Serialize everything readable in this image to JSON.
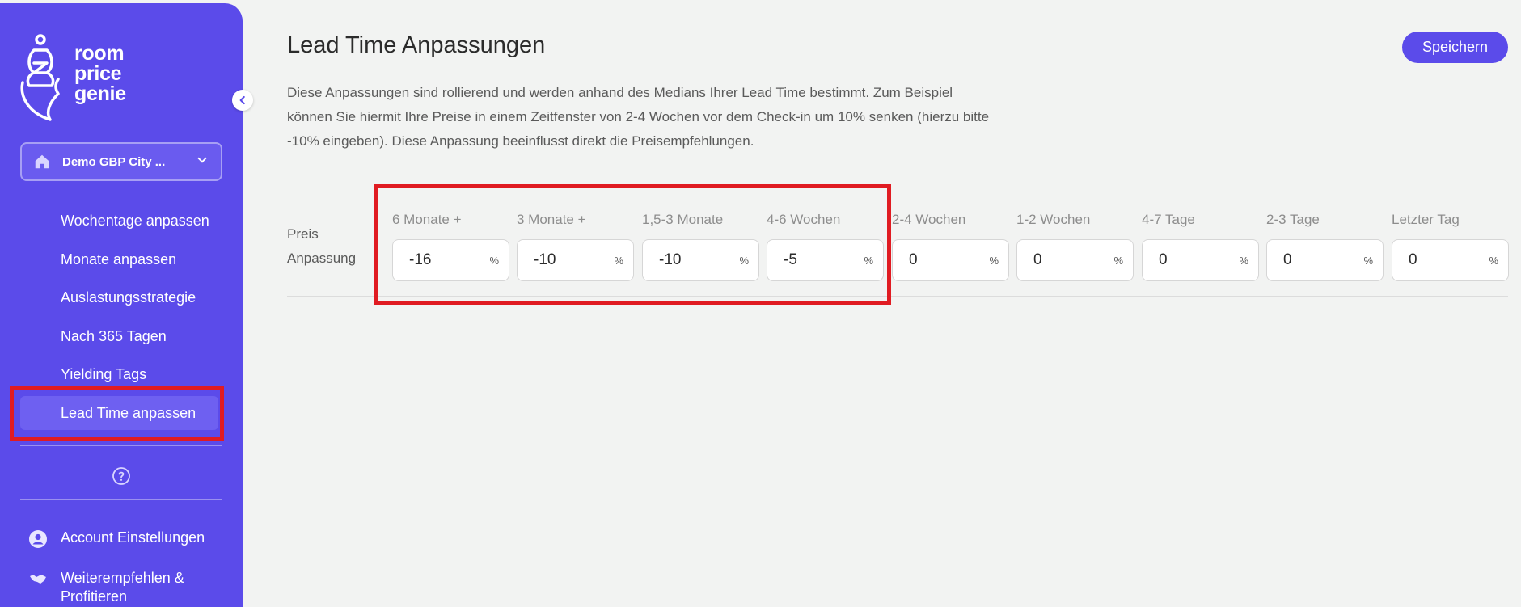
{
  "brand": {
    "line1": "room",
    "line2": "price",
    "line3": "genie"
  },
  "property": {
    "name": "Demo GBP City ..."
  },
  "nav": {
    "items": [
      {
        "label": "Wochentage anpassen"
      },
      {
        "label": "Monate anpassen"
      },
      {
        "label": "Auslastungsstrategie"
      },
      {
        "label": "Nach 365 Tagen"
      },
      {
        "label": "Yielding Tags"
      },
      {
        "label": "Lead Time anpassen"
      }
    ],
    "account": "Account Einstellungen",
    "refer_line1": "Weiterempfehlen &",
    "refer_line2": "Profitieren"
  },
  "main": {
    "title": "Lead Time Anpassungen",
    "save_label": "Speichern",
    "description": [
      "Diese Anpassungen sind rollierend und werden anhand des Medians Ihrer Lead Time bestimmt. Zum Beispiel",
      "können Sie hiermit Ihre Preise in einem Zeitfenster von 2-4 Wochen vor dem Check-in um 10% senken (hierzu bitte",
      "-10% eingeben). Diese Anpassung beeinflusst direkt die Preisempfehlungen."
    ],
    "row_label_line1": "Preis",
    "row_label_line2": "Anpassung",
    "unit": "%",
    "columns": [
      {
        "label": "6 Monate +",
        "value": "-16"
      },
      {
        "label": "3 Monate +",
        "value": "-10"
      },
      {
        "label": "1,5-3 Monate",
        "value": "-10"
      },
      {
        "label": "4-6 Wochen",
        "value": "-5"
      },
      {
        "label": "2-4 Wochen",
        "value": "0"
      },
      {
        "label": "1-2 Wochen",
        "value": "0"
      },
      {
        "label": "4-7 Tage",
        "value": "0"
      },
      {
        "label": "2-3 Tage",
        "value": "0"
      },
      {
        "label": "Letzter Tag",
        "value": "0"
      }
    ]
  },
  "colors": {
    "brand": "#5b4bea",
    "highlight": "#e01b22",
    "background": "#f2f3f2"
  }
}
